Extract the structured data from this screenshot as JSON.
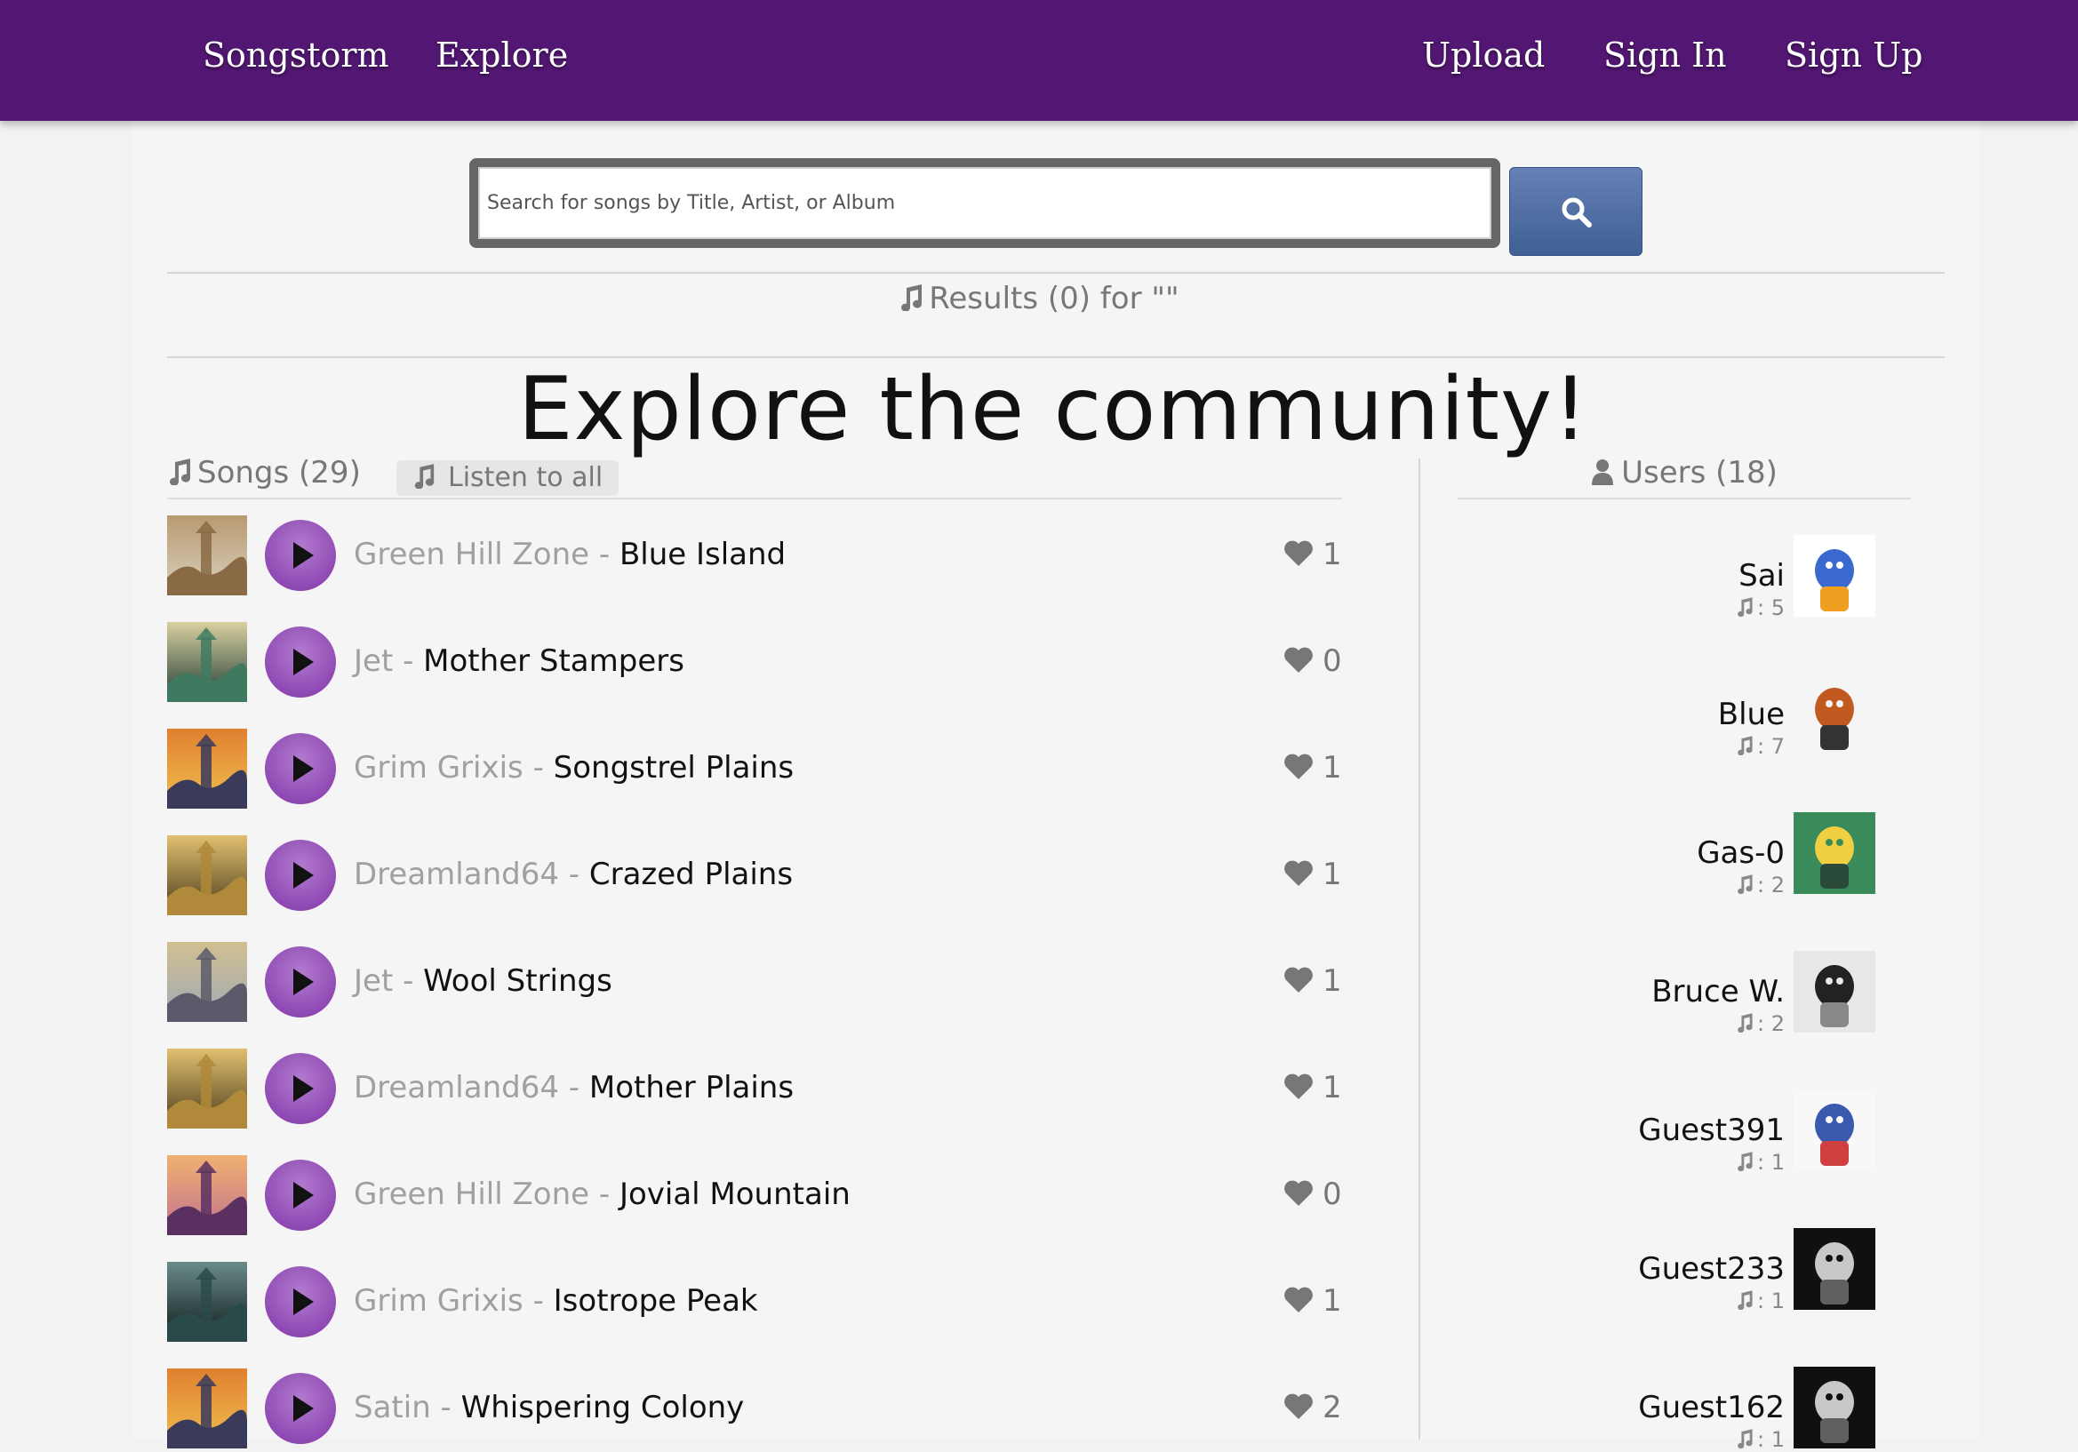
{
  "nav": {
    "brand": "Songstorm",
    "explore": "Explore",
    "upload": "Upload",
    "sign_in": "Sign In",
    "sign_up": "Sign Up",
    "color": "#521772"
  },
  "search": {
    "placeholder": "Search for songs by Title, Artist, or Album",
    "value": "",
    "button_icon": "search-icon"
  },
  "results": {
    "text": "Results (0) for \"\""
  },
  "hero": {
    "title": "Explore the community!"
  },
  "songs": {
    "header": "Songs (29)",
    "listen_all": "Listen to all",
    "separator": " - ",
    "items": [
      {
        "artist": "Green Hill Zone",
        "title": "Blue Island",
        "likes": "1",
        "thumb": "steampunk-tower"
      },
      {
        "artist": "Jet",
        "title": "Mother Stampers",
        "likes": "0",
        "thumb": "green-castle"
      },
      {
        "artist": "Grim Grixis",
        "title": "Songstrel Plains",
        "likes": "1",
        "thumb": "sunset-tower"
      },
      {
        "artist": "Dreamland64",
        "title": "Crazed Plains",
        "likes": "1",
        "thumb": "golden-forest"
      },
      {
        "artist": "Jet",
        "title": "Wool Strings",
        "likes": "1",
        "thumb": "fantasy-city"
      },
      {
        "artist": "Dreamland64",
        "title": "Mother Plains",
        "likes": "1",
        "thumb": "golden-forest"
      },
      {
        "artist": "Green Hill Zone",
        "title": "Jovial Mountain",
        "likes": "0",
        "thumb": "purple-mountain"
      },
      {
        "artist": "Grim Grixis",
        "title": "Isotrope Peak",
        "likes": "1",
        "thumb": "dark-forest"
      },
      {
        "artist": "Satin",
        "title": "Whispering Colony",
        "likes": "2",
        "thumb": "sunset-tower"
      }
    ]
  },
  "users": {
    "header": "Users (18)",
    "items": [
      {
        "name": "Sai",
        "songs": ": 5",
        "avatar": "duck-avatar"
      },
      {
        "name": "Blue",
        "songs": ": 7",
        "avatar": "pixel-trainer-avatar"
      },
      {
        "name": "Gas-0",
        "songs": ": 2",
        "avatar": "cartoon-avatar"
      },
      {
        "name": "Bruce W.",
        "songs": ": 2",
        "avatar": "batman-avatar"
      },
      {
        "name": "Guest391",
        "songs": ": 1",
        "avatar": "group-art-avatar"
      },
      {
        "name": "Guest233",
        "songs": ": 1",
        "avatar": "silver-crest-avatar"
      },
      {
        "name": "Guest162",
        "songs": ": 1",
        "avatar": "silver-crest-avatar"
      }
    ]
  },
  "colors": {
    "play": "#8f4ab3",
    "search_button": "#4f6ea3",
    "muted_text": "#777777"
  }
}
